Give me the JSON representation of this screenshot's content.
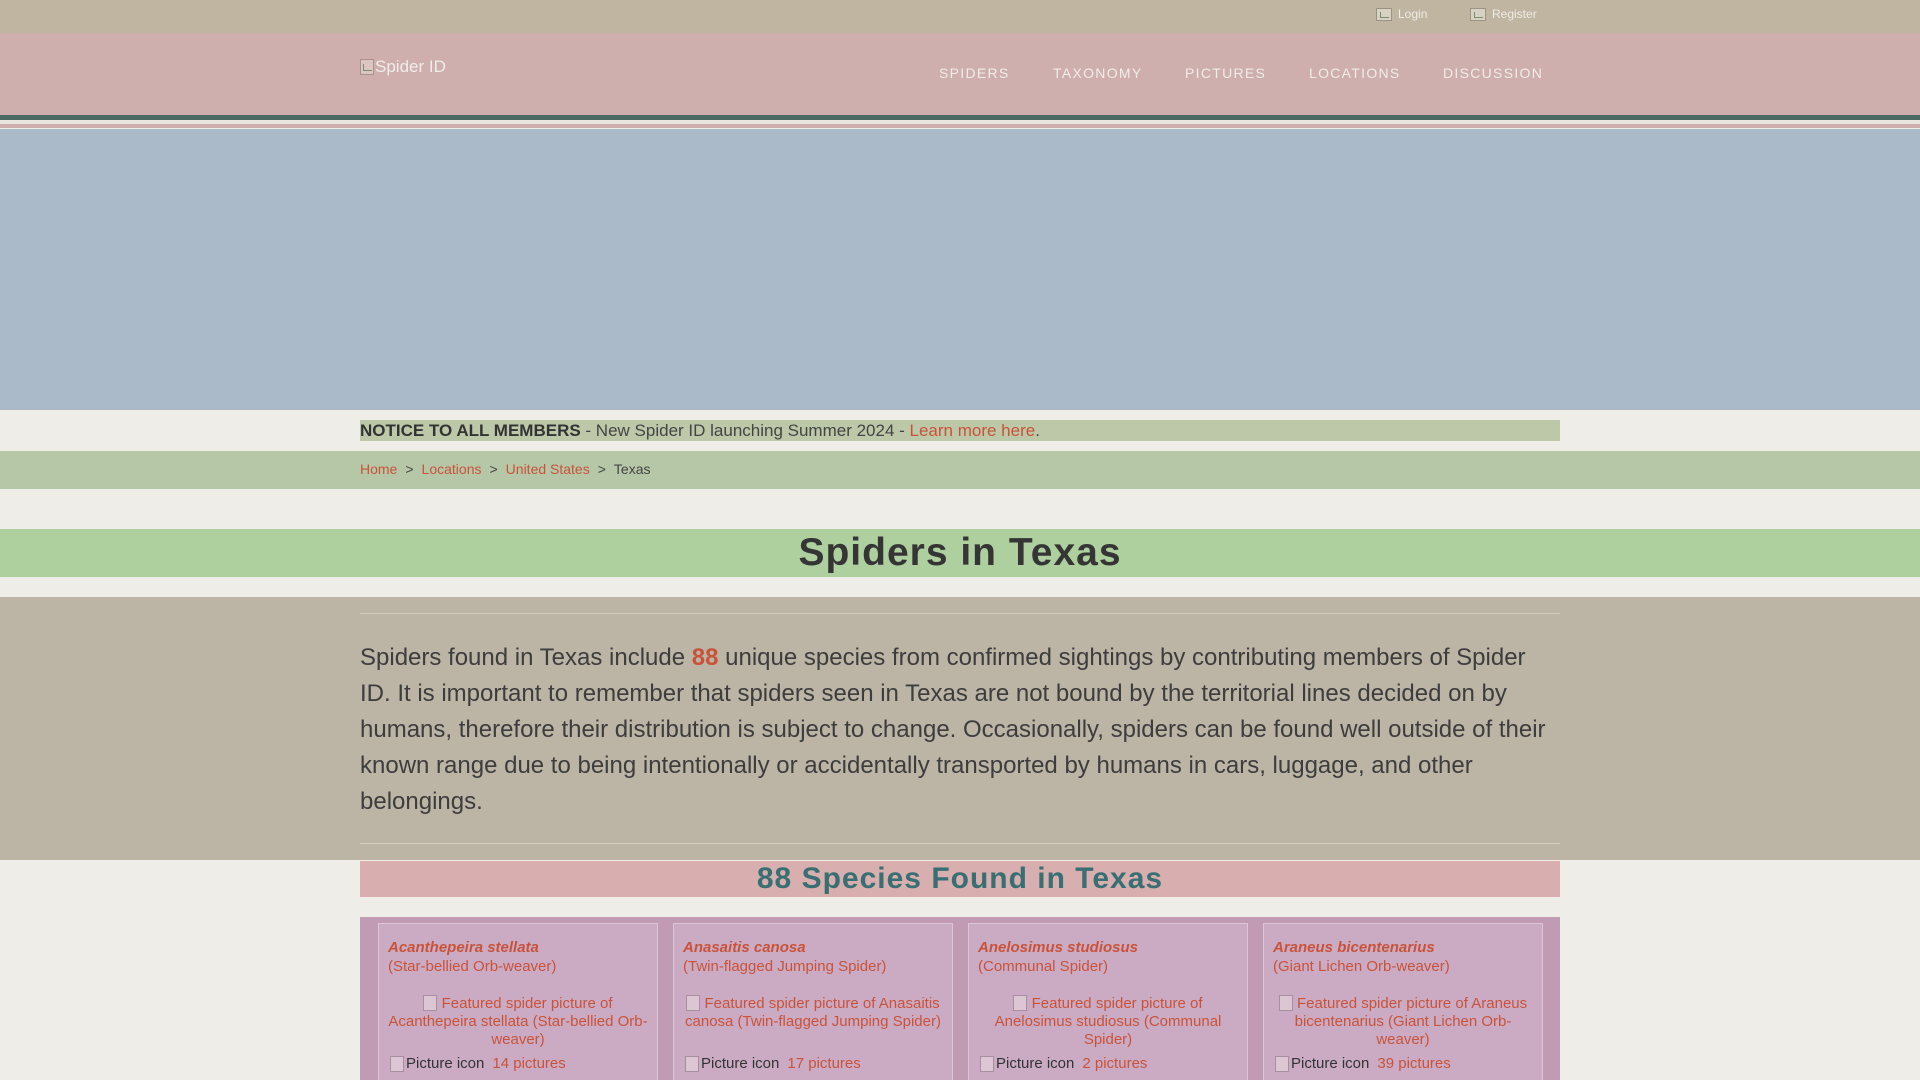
{
  "topbar": {
    "login": "Login",
    "register": "Register"
  },
  "nav": {
    "logo_alt": "Spider ID",
    "items": [
      "SPIDERS",
      "TAXONOMY",
      "PICTURES",
      "LOCATIONS",
      "DISCUSSION"
    ]
  },
  "notice": {
    "title": "NOTICE TO ALL MEMBERS",
    "text": " - New Spider ID launching Summer 2024 - ",
    "link": "Learn more here",
    "end": "."
  },
  "breadcrumb": {
    "home": "Home",
    "locations": "Locations",
    "country": "United States",
    "current": "Texas",
    "sep": ">"
  },
  "page": {
    "title": "Spiders in Texas",
    "intro_before": "Spiders found in Texas include ",
    "count": "88",
    "intro_after": " unique species from confirmed sightings by contributing members of Spider ID. It is important to remember that spiders seen in Texas are not bound by the territorial lines decided on by humans, therefore their distribution is subject to change. Occasionally, spiders can be found well outside of their known range due to being intentionally or accidentally transported by humans in cars, luggage, and other belongings.",
    "species_heading": "88 Species Found in Texas"
  },
  "species": [
    {
      "scientific": "Acanthepeira stellata",
      "common": "(Star-bellied Orb-weaver)",
      "image_alt": "Featured spider picture of Acanthepeira stellata (Star-bellied Orb-weaver)",
      "picture_icon": "Picture icon",
      "pictures": "14 pictures"
    },
    {
      "scientific": "Anasaitis canosa",
      "common": "(Twin-flagged Jumping Spider)",
      "image_alt": "Featured spider picture of Anasaitis canosa (Twin-flagged Jumping Spider)",
      "picture_icon": "Picture icon",
      "pictures": "17 pictures"
    },
    {
      "scientific": "Anelosimus studiosus",
      "common": "(Communal Spider)",
      "image_alt": "Featured spider picture of Anelosimus studiosus (Communal Spider)",
      "picture_icon": "Picture icon",
      "pictures": "2 pictures"
    },
    {
      "scientific": "Araneus bicentenarius",
      "common": "(Giant Lichen Orb-weaver)",
      "image_alt": "Featured spider picture of Araneus bicentenarius (Giant Lichen Orb-weaver)",
      "picture_icon": "Picture icon",
      "pictures": "39 pictures"
    }
  ],
  "colors": {
    "accent": "#c8533a",
    "nav_bg": "#cfaeae",
    "title_bar": "#aed09f",
    "heading_teal": "#376f73"
  }
}
